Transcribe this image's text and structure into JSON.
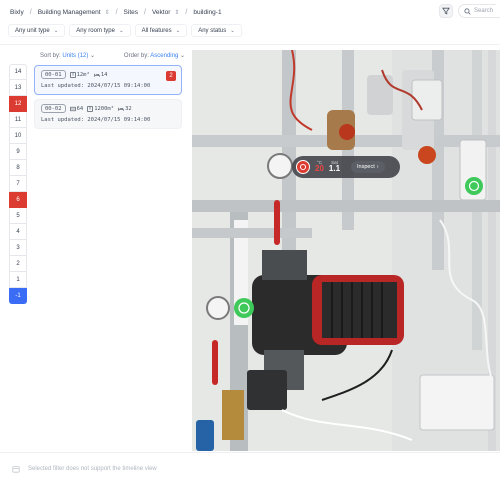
{
  "breadcrumb": [
    {
      "label": "Bixly",
      "dropdown": false
    },
    {
      "label": "Building Management",
      "dropdown": true
    },
    {
      "label": "Sites",
      "dropdown": false
    },
    {
      "label": "Vektor",
      "dropdown": true
    },
    {
      "label": "building-1",
      "dropdown": false
    }
  ],
  "search": {
    "placeholder": "Search"
  },
  "filters": [
    "Any unit type",
    "Any room type",
    "All features",
    "Any status"
  ],
  "sort": {
    "label": "Sort by:",
    "value": "Units (12)",
    "order_label": "Order by:",
    "order_value": "Ascending"
  },
  "floors": [
    "14",
    "13",
    "12",
    "11",
    "10",
    "9",
    "8",
    "7",
    "6",
    "5",
    "4",
    "3",
    "2",
    "1",
    "-1"
  ],
  "floor_states": {
    "12": "red",
    "6": "red",
    "-1": "blue"
  },
  "units": [
    {
      "code": "00-01",
      "area": "12m²",
      "count": "14",
      "badge": "2",
      "updated": "Last updated: 2024/07/15 09:14:00"
    },
    {
      "code": "00-02",
      "area": "1200m²",
      "count_a": "64",
      "count": "32",
      "updated": "Last updated: 2024/07/15 09:14:00"
    }
  ],
  "overlay": {
    "temp_label": "°C",
    "temp_value": "20",
    "sat_label": "Sat",
    "sat_value": "1.1",
    "inspect": "Inspect"
  },
  "footer": {
    "message": "Selected filter does not support the timeline view"
  },
  "colors": {
    "accent": "#3b82f6",
    "alert": "#dc3b31",
    "floor_active": "#3b6cf6"
  }
}
